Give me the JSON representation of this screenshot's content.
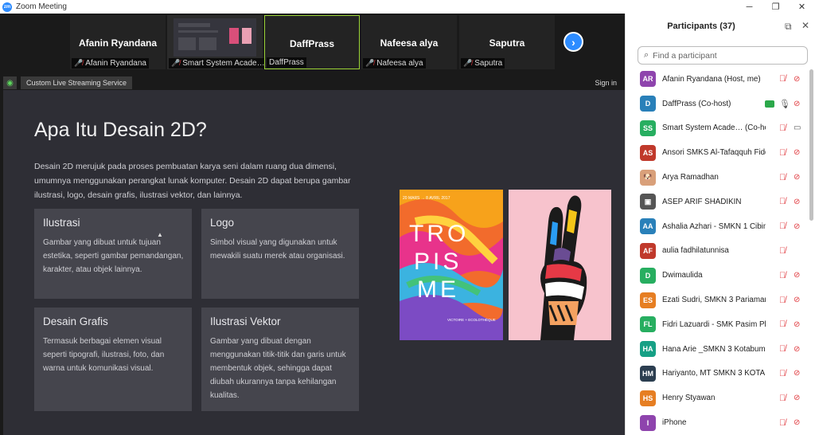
{
  "window": {
    "title": "Zoom Meeting",
    "app_icon": "zm",
    "minimize": "─",
    "maximize": "❐",
    "close": "✕"
  },
  "video_strip": {
    "tiles": [
      {
        "display_name": "Afanin Ryandana",
        "tag": "Afanin Ryandana",
        "muted": true
      },
      {
        "display_name": "",
        "tag": "Smart System Acade…",
        "muted": true
      },
      {
        "display_name": "DaffPrass",
        "tag": "DaffPrass",
        "muted": false
      },
      {
        "display_name": "Nafeesa alya",
        "tag": "Nafeesa alya",
        "muted": true
      },
      {
        "display_name": "Saputra",
        "tag": "Saputra",
        "muted": true
      }
    ],
    "next_label": "›"
  },
  "streambar": {
    "label": "Custom Live Streaming Service",
    "signin": "Sign in"
  },
  "slide": {
    "title": "Apa Itu Desain 2D?",
    "intro": "Desain 2D merujuk pada proses pembuatan karya seni dalam ruang dua dimensi, umumnya menggunakan perangkat lunak komputer. Desain 2D dapat berupa gambar ilustrasi, logo, desain grafis, ilustrasi vektor, dan lainnya.",
    "cards": [
      {
        "title": "Ilustrasi",
        "text": "Gambar yang dibuat untuk tujuan estetika, seperti gambar pemandangan, karakter, atau objek lainnya."
      },
      {
        "title": "Logo",
        "text": "Simbol visual yang digunakan untuk mewakili suatu merek atau organisasi."
      },
      {
        "title": "Desain Grafis",
        "text": "Termasuk berbagai elemen visual seperti tipografi, ilustrasi, foto, dan warna untuk komunikasi visual."
      },
      {
        "title": "Ilustrasi Vektor",
        "text": "Gambar yang dibuat dengan menggunakan titik-titik dan garis untuk membentuk objek, sehingga dapat diubah ukurannya tanpa kehilangan kualitas."
      }
    ],
    "poster": {
      "date": "20 MARS → 8 AVRIL 2017",
      "word1": "TRO",
      "word2": "PIS",
      "word3": "ME",
      "footer": "VICTOIRE + ECOLOTHÈQUE"
    }
  },
  "participants": {
    "title": "Participants (37)",
    "search_placeholder": "Find a participant",
    "list": [
      {
        "initials": "AR",
        "name": "Afanin Ryandana (Host, me)",
        "color": "#8e44ad",
        "mic": "off",
        "cam": "off"
      },
      {
        "initials": "D",
        "name": "DaffPrass (Co-host)",
        "color": "#2980b9",
        "mic": "on",
        "cam": "off",
        "sharing": true
      },
      {
        "initials": "SS",
        "name": "Smart System Acade… (Co-host)",
        "color": "#27ae60",
        "mic": "off",
        "cam": "on"
      },
      {
        "initials": "AS",
        "name": "Ansori SMKS Al-Tafaqquh Fiddi…",
        "color": "#c0392b",
        "mic": "off",
        "cam": "off"
      },
      {
        "initials": "🐶",
        "name": "Arya Ramadhan",
        "color": "#d9a07a",
        "mic": "off",
        "cam": "off"
      },
      {
        "initials": "▣",
        "name": "ASEP ARIF SHADIKIN",
        "color": "#555555",
        "mic": "off",
        "cam": "off"
      },
      {
        "initials": "AA",
        "name": "Ashalia Azhari - SMKN 1 Cibin…",
        "color": "#2980b9",
        "mic": "off",
        "cam": "off"
      },
      {
        "initials": "AF",
        "name": "aulia fadhilatunnisa",
        "color": "#c0392b",
        "mic": "off",
        "cam": "none"
      },
      {
        "initials": "D",
        "name": "Dwimaulida",
        "color": "#27ae60",
        "mic": "off",
        "cam": "off"
      },
      {
        "initials": "ES",
        "name": "Ezati Sudri, SMKN 3 Pariaman",
        "color": "#e67e22",
        "mic": "off",
        "cam": "off"
      },
      {
        "initials": "FL",
        "name": "Fidri Lazuardi - SMK Pasim Plus",
        "color": "#27ae60",
        "mic": "off",
        "cam": "off"
      },
      {
        "initials": "HA",
        "name": "Hana Arie _SMKN 3 Kotabumi",
        "color": "#16a085",
        "mic": "off",
        "cam": "off"
      },
      {
        "initials": "HM",
        "name": "Hariyanto, MT SMKN 3 KOTAB…",
        "color": "#2c3e50",
        "mic": "off",
        "cam": "off"
      },
      {
        "initials": "HS",
        "name": "Henry Styawan",
        "color": "#e67e22",
        "mic": "off",
        "cam": "off"
      },
      {
        "initials": "I",
        "name": "iPhone",
        "color": "#8e44ad",
        "mic": "off",
        "cam": "off"
      }
    ]
  }
}
